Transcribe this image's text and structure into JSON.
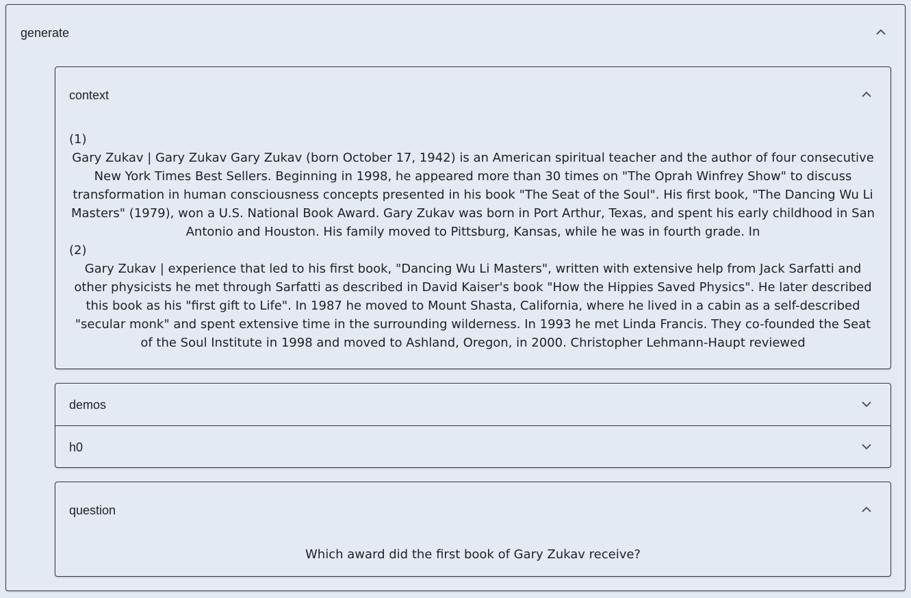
{
  "generate": {
    "title": "generate",
    "expanded": true
  },
  "context": {
    "title": "context",
    "expanded": true,
    "items": [
      {
        "number": "(1)",
        "text": "Gary Zukav | Gary Zukav Gary Zukav (born October 17, 1942) is an American spiritual teacher and the author of four consecutive New York Times Best Sellers. Beginning in 1998, he appeared more than 30 times on \"The Oprah Winfrey Show\" to discuss transformation in human consciousness concepts presented in his book \"The Seat of the Soul\". His first book, \"The Dancing Wu Li Masters\" (1979), won a U.S. National Book Award. Gary Zukav was born in Port Arthur, Texas, and spent his early childhood in San Antonio and Houston. His family moved to Pittsburg, Kansas, while he was in fourth grade. In"
      },
      {
        "number": "(2)",
        "text": "Gary Zukav | experience that led to his first book, \"Dancing Wu Li Masters\", written with extensive help from Jack Sarfatti and other physicists he met through Sarfatti as described in David Kaiser's book \"How the Hippies Saved Physics\". He later described this book as his \"first gift to Life\". In 1987 he moved to Mount Shasta, California, where he lived in a cabin as a self-described \"secular monk\" and spent extensive time in the surrounding wilderness. In 1993 he met Linda Francis. They co-founded the Seat of the Soul Institute in 1998 and moved to Ashland, Oregon, in 2000. Christopher Lehmann-Haupt reviewed"
      }
    ]
  },
  "demos": {
    "title": "demos",
    "expanded": false
  },
  "h0": {
    "title": "h0",
    "expanded": false
  },
  "question": {
    "title": "question",
    "expanded": true,
    "text": "Which award did the first book of Gary Zukav receive?"
  },
  "icons": {
    "expanded": "chevron-up-icon",
    "collapsed": "chevron-down-icon"
  }
}
